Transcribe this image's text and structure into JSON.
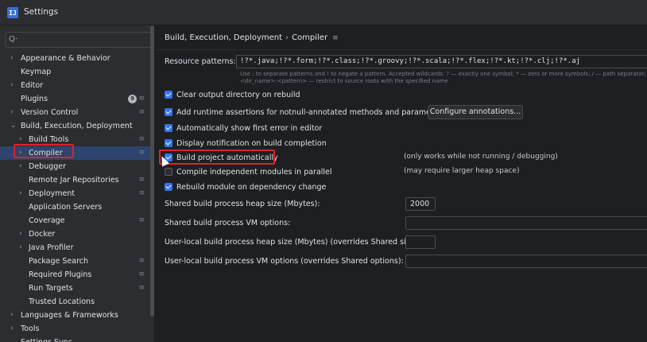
{
  "window": {
    "title": "Settings",
    "icon_text": "IJ"
  },
  "sidebar": {
    "search_placeholder": "",
    "items": [
      {
        "label": "Appearance & Behavior",
        "arrow": ">",
        "indent": 0,
        "mark": ""
      },
      {
        "label": "Keymap",
        "arrow": "",
        "indent": 0,
        "mark": ""
      },
      {
        "label": "Editor",
        "arrow": ">",
        "indent": 0,
        "mark": ""
      },
      {
        "label": "Plugins",
        "arrow": "",
        "indent": 0,
        "mark": "≡",
        "badge": "9"
      },
      {
        "label": "Version Control",
        "arrow": ">",
        "indent": 0,
        "mark": "≡"
      },
      {
        "label": "Build, Execution, Deployment",
        "arrow": "v",
        "indent": 0,
        "mark": ""
      },
      {
        "label": "Build Tools",
        "arrow": ">",
        "indent": 1,
        "mark": "≡"
      },
      {
        "label": "Compiler",
        "arrow": ">",
        "indent": 1,
        "mark": "≡",
        "selected": true
      },
      {
        "label": "Debugger",
        "arrow": ">",
        "indent": 1,
        "mark": ""
      },
      {
        "label": "Remote Jar Repositories",
        "arrow": "",
        "indent": 1,
        "mark": "≡"
      },
      {
        "label": "Deployment",
        "arrow": ">",
        "indent": 1,
        "mark": "≡"
      },
      {
        "label": "Application Servers",
        "arrow": "",
        "indent": 1,
        "mark": ""
      },
      {
        "label": "Coverage",
        "arrow": "",
        "indent": 1,
        "mark": "≡"
      },
      {
        "label": "Docker",
        "arrow": ">",
        "indent": 1,
        "mark": ""
      },
      {
        "label": "Java Profiler",
        "arrow": ">",
        "indent": 1,
        "mark": ""
      },
      {
        "label": "Package Search",
        "arrow": "",
        "indent": 1,
        "mark": "≡"
      },
      {
        "label": "Required Plugins",
        "arrow": "",
        "indent": 1,
        "mark": "≡"
      },
      {
        "label": "Run Targets",
        "arrow": "",
        "indent": 1,
        "mark": "≡"
      },
      {
        "label": "Trusted Locations",
        "arrow": "",
        "indent": 1,
        "mark": ""
      },
      {
        "label": "Languages & Frameworks",
        "arrow": ">",
        "indent": 0,
        "mark": ""
      },
      {
        "label": "Tools",
        "arrow": ">",
        "indent": 0,
        "mark": ""
      },
      {
        "label": "Settings Sync",
        "arrow": "",
        "indent": 0,
        "mark": ""
      }
    ]
  },
  "breadcrumb": {
    "parent": "Build, Execution, Deployment",
    "separator": "›",
    "current": "Compiler",
    "menu_icon": "≡"
  },
  "resource": {
    "label": "Resource patterns:",
    "value": "!?*.java;!?*.form;!?*.class;!?*.groovy;!?*.scala;!?*.flex;!?*.kt;!?*.clj;!?*.aj",
    "hint1": "Use ; to separate patterns and ! to negate a pattern. Accepted wildcards: ? — exactly one symbol; * — zero or more symbols; / — path separator;",
    "hint2": "<dir_name>:<pattern> — restrict to source roots with the specified name"
  },
  "options": {
    "clear_output": "Clear output directory on rebuild",
    "runtime_assertions": "Add runtime assertions for notnull-annotated methods and parameters",
    "configure_annotations": "Configure annotations...",
    "show_first_error": "Automatically show first error in editor",
    "display_notification": "Display notification on build completion",
    "build_automatically": "Build project automatically",
    "build_automatically_note": "(only works while not running / debugging)",
    "compile_parallel": "Compile independent modules in parallel",
    "compile_parallel_note": "(may require larger heap space)",
    "rebuild_module": "Rebuild module on dependency change"
  },
  "fields": {
    "shared_heap_label": "Shared build process heap size (Mbytes):",
    "shared_heap_value": "2000",
    "shared_vm_label": "Shared build process VM options:",
    "shared_vm_value": "",
    "user_heap_label": "User-local build process heap size (Mbytes) (overrides Shared size):",
    "user_heap_value": "",
    "user_vm_label": "User-local build process VM options (overrides Shared options):",
    "user_vm_value": ""
  },
  "icons": {
    "search": "search-icon",
    "menu": "hamburger-icon"
  },
  "colors": {
    "accent": "#3574f0",
    "highlight": "#e0202f",
    "selection": "#2e436e"
  }
}
